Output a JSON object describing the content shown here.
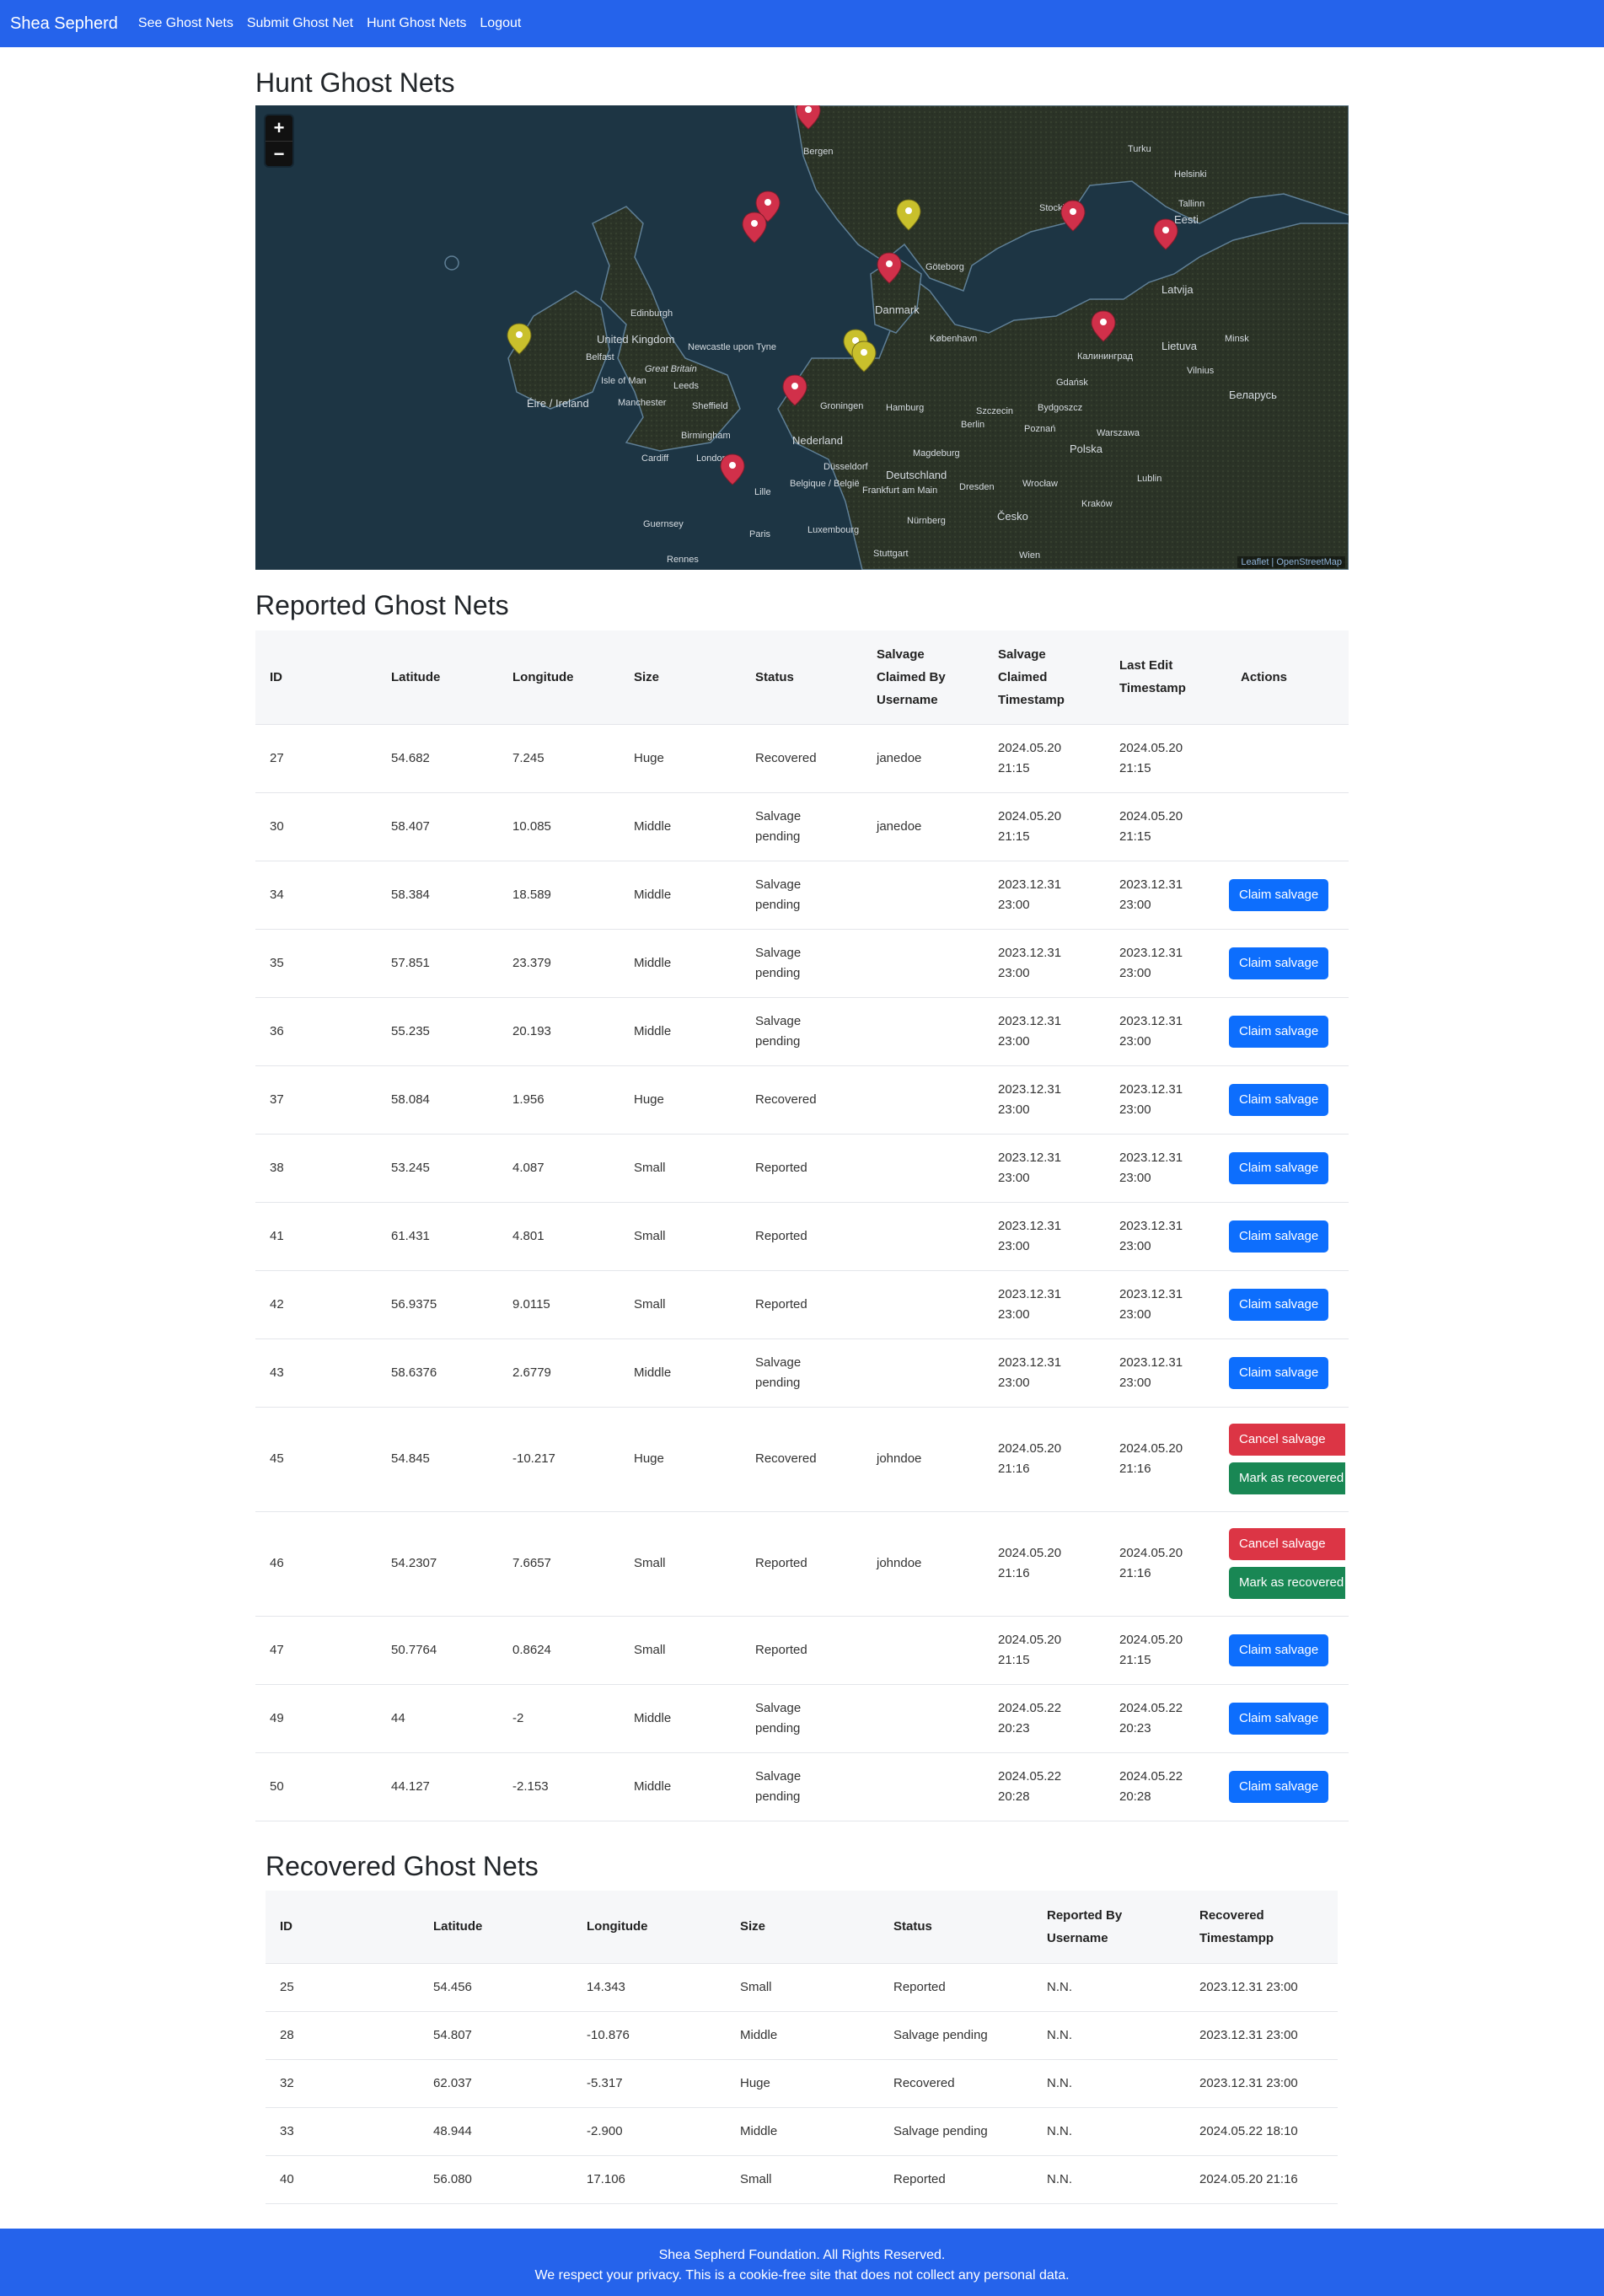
{
  "nav": {
    "brand": "Shea Sepherd",
    "links": [
      "See Ghost Nets",
      "Submit Ghost Net",
      "Hunt Ghost Nets",
      "Logout"
    ]
  },
  "hunt": {
    "title": "Hunt Ghost Nets",
    "map": {
      "zoom_in": "+",
      "zoom_out": "−",
      "attribution": "Leaflet | OpenStreetMap",
      "place_labels": [
        "Bergen",
        "Turku",
        "Helsinki",
        "Tallinn",
        "Eesti",
        "Stockholm",
        "Göteborg",
        "Latvija",
        "Danmark",
        "København",
        "Edinburgh",
        "United Kingdom",
        "Newcastle upon Tyne",
        "Belfast",
        "Great Britain",
        "Isle of Man",
        "Leeds",
        "Éire / Ireland",
        "Manchester",
        "Sheffield",
        "Birmingham",
        "Cardiff",
        "London",
        "Nederland",
        "Groningen",
        "Hamburg",
        "Berlin",
        "Szczecin",
        "Bydgoszcz",
        "Gdańsk",
        "Калининград",
        "Lietuva",
        "Vilnius",
        "Беларусь",
        "Poznań",
        "Warszawa",
        "Polska",
        "Deutschland",
        "Düsseldorf",
        "Belgique / België",
        "Frankfurt am Main",
        "Magdeburg",
        "Dresden",
        "Wrocław",
        "Lublin",
        "Kraków",
        "Česko",
        "Paris",
        "Luxembourg",
        "Nürnberg",
        "Stuttgart",
        "Wien",
        "Guernsey",
        "Rennes",
        "Lille",
        "Minsk"
      ]
    }
  },
  "reported": {
    "title": "Reported Ghost Nets",
    "headers": [
      "ID",
      "Latitude",
      "Longitude",
      "Size",
      "Status",
      "Salvage Claimed By Username",
      "Salvage Claimed Timestamp",
      "Last Edit Timestamp",
      "Actions"
    ],
    "rows": [
      {
        "id": "27",
        "lat": "54.682",
        "lon": "7.245",
        "size": "Huge",
        "status": "Recovered",
        "claimed_by": "janedoe",
        "claimed_ts": "2024.05.20 21:15",
        "edit_ts": "2024.05.20 21:15",
        "actions": []
      },
      {
        "id": "30",
        "lat": "58.407",
        "lon": "10.085",
        "size": "Middle",
        "status": "Salvage pending",
        "claimed_by": "janedoe",
        "claimed_ts": "2024.05.20 21:15",
        "edit_ts": "2024.05.20 21:15",
        "actions": []
      },
      {
        "id": "34",
        "lat": "58.384",
        "lon": "18.589",
        "size": "Middle",
        "status": "Salvage pending",
        "claimed_by": "",
        "claimed_ts": "2023.12.31 23:00",
        "edit_ts": "2023.12.31 23:00",
        "actions": [
          "Claim salvage"
        ]
      },
      {
        "id": "35",
        "lat": "57.851",
        "lon": "23.379",
        "size": "Middle",
        "status": "Salvage pending",
        "claimed_by": "",
        "claimed_ts": "2023.12.31 23:00",
        "edit_ts": "2023.12.31 23:00",
        "actions": [
          "Claim salvage"
        ]
      },
      {
        "id": "36",
        "lat": "55.235",
        "lon": "20.193",
        "size": "Middle",
        "status": "Salvage pending",
        "claimed_by": "",
        "claimed_ts": "2023.12.31 23:00",
        "edit_ts": "2023.12.31 23:00",
        "actions": [
          "Claim salvage"
        ]
      },
      {
        "id": "37",
        "lat": "58.084",
        "lon": "1.956",
        "size": "Huge",
        "status": "Recovered",
        "claimed_by": "",
        "claimed_ts": "2023.12.31 23:00",
        "edit_ts": "2023.12.31 23:00",
        "actions": [
          "Claim salvage"
        ]
      },
      {
        "id": "38",
        "lat": "53.245",
        "lon": "4.087",
        "size": "Small",
        "status": "Reported",
        "claimed_by": "",
        "claimed_ts": "2023.12.31 23:00",
        "edit_ts": "2023.12.31 23:00",
        "actions": [
          "Claim salvage"
        ]
      },
      {
        "id": "41",
        "lat": "61.431",
        "lon": "4.801",
        "size": "Small",
        "status": "Reported",
        "claimed_by": "",
        "claimed_ts": "2023.12.31 23:00",
        "edit_ts": "2023.12.31 23:00",
        "actions": [
          "Claim salvage"
        ]
      },
      {
        "id": "42",
        "lat": "56.9375",
        "lon": "9.0115",
        "size": "Small",
        "status": "Reported",
        "claimed_by": "",
        "claimed_ts": "2023.12.31 23:00",
        "edit_ts": "2023.12.31 23:00",
        "actions": [
          "Claim salvage"
        ]
      },
      {
        "id": "43",
        "lat": "58.6376",
        "lon": "2.6779",
        "size": "Middle",
        "status": "Salvage pending",
        "claimed_by": "",
        "claimed_ts": "2023.12.31 23:00",
        "edit_ts": "2023.12.31 23:00",
        "actions": [
          "Claim salvage"
        ]
      },
      {
        "id": "45",
        "lat": "54.845",
        "lon": "-10.217",
        "size": "Huge",
        "status": "Recovered",
        "claimed_by": "johndoe",
        "claimed_ts": "2024.05.20 21:16",
        "edit_ts": "2024.05.20 21:16",
        "actions": [
          "Cancel salvage",
          "Mark as recovered"
        ]
      },
      {
        "id": "46",
        "lat": "54.2307",
        "lon": "7.6657",
        "size": "Small",
        "status": "Reported",
        "claimed_by": "johndoe",
        "claimed_ts": "2024.05.20 21:16",
        "edit_ts": "2024.05.20 21:16",
        "actions": [
          "Cancel salvage",
          "Mark as recovered"
        ]
      },
      {
        "id": "47",
        "lat": "50.7764",
        "lon": "0.8624",
        "size": "Small",
        "status": "Reported",
        "claimed_by": "",
        "claimed_ts": "2024.05.20 21:15",
        "edit_ts": "2024.05.20 21:15",
        "actions": [
          "Claim salvage"
        ]
      },
      {
        "id": "49",
        "lat": "44",
        "lon": "-2",
        "size": "Middle",
        "status": "Salvage pending",
        "claimed_by": "",
        "claimed_ts": "2024.05.22 20:23",
        "edit_ts": "2024.05.22 20:23",
        "actions": [
          "Claim salvage"
        ]
      },
      {
        "id": "50",
        "lat": "44.127",
        "lon": "-2.153",
        "size": "Middle",
        "status": "Salvage pending",
        "claimed_by": "",
        "claimed_ts": "2024.05.22 20:28",
        "edit_ts": "2024.05.22 20:28",
        "actions": [
          "Claim salvage"
        ]
      }
    ]
  },
  "recovered": {
    "title": "Recovered Ghost Nets",
    "headers": [
      "ID",
      "Latitude",
      "Longitude",
      "Size",
      "Status",
      "Reported By Username",
      "Recovered Timestampp"
    ],
    "rows": [
      {
        "id": "25",
        "lat": "54.456",
        "lon": "14.343",
        "size": "Small",
        "status": "Reported",
        "reported_by": "N.N.",
        "recovered_ts": "2023.12.31 23:00"
      },
      {
        "id": "28",
        "lat": "54.807",
        "lon": "-10.876",
        "size": "Middle",
        "status": "Salvage pending",
        "reported_by": "N.N.",
        "recovered_ts": "2023.12.31 23:00"
      },
      {
        "id": "32",
        "lat": "62.037",
        "lon": "-5.317",
        "size": "Huge",
        "status": "Recovered",
        "reported_by": "N.N.",
        "recovered_ts": "2023.12.31 23:00"
      },
      {
        "id": "33",
        "lat": "48.944",
        "lon": "-2.900",
        "size": "Middle",
        "status": "Salvage pending",
        "reported_by": "N.N.",
        "recovered_ts": "2024.05.22 18:10"
      },
      {
        "id": "40",
        "lat": "56.080",
        "lon": "17.106",
        "size": "Small",
        "status": "Reported",
        "reported_by": "N.N.",
        "recovered_ts": "2024.05.20 21:16"
      }
    ]
  },
  "footer": {
    "line1": "Shea Sepherd Foundation. All Rights Reserved.",
    "line2": "We respect your privacy. This is a cookie-free site that does not collect any personal data."
  },
  "colors": {
    "brand_blue": "#2563eb",
    "primary": "#0d6efd",
    "danger": "#dc3545",
    "success": "#198754",
    "marker_red": "#d1304a",
    "marker_yellow": "#c9c02c"
  }
}
